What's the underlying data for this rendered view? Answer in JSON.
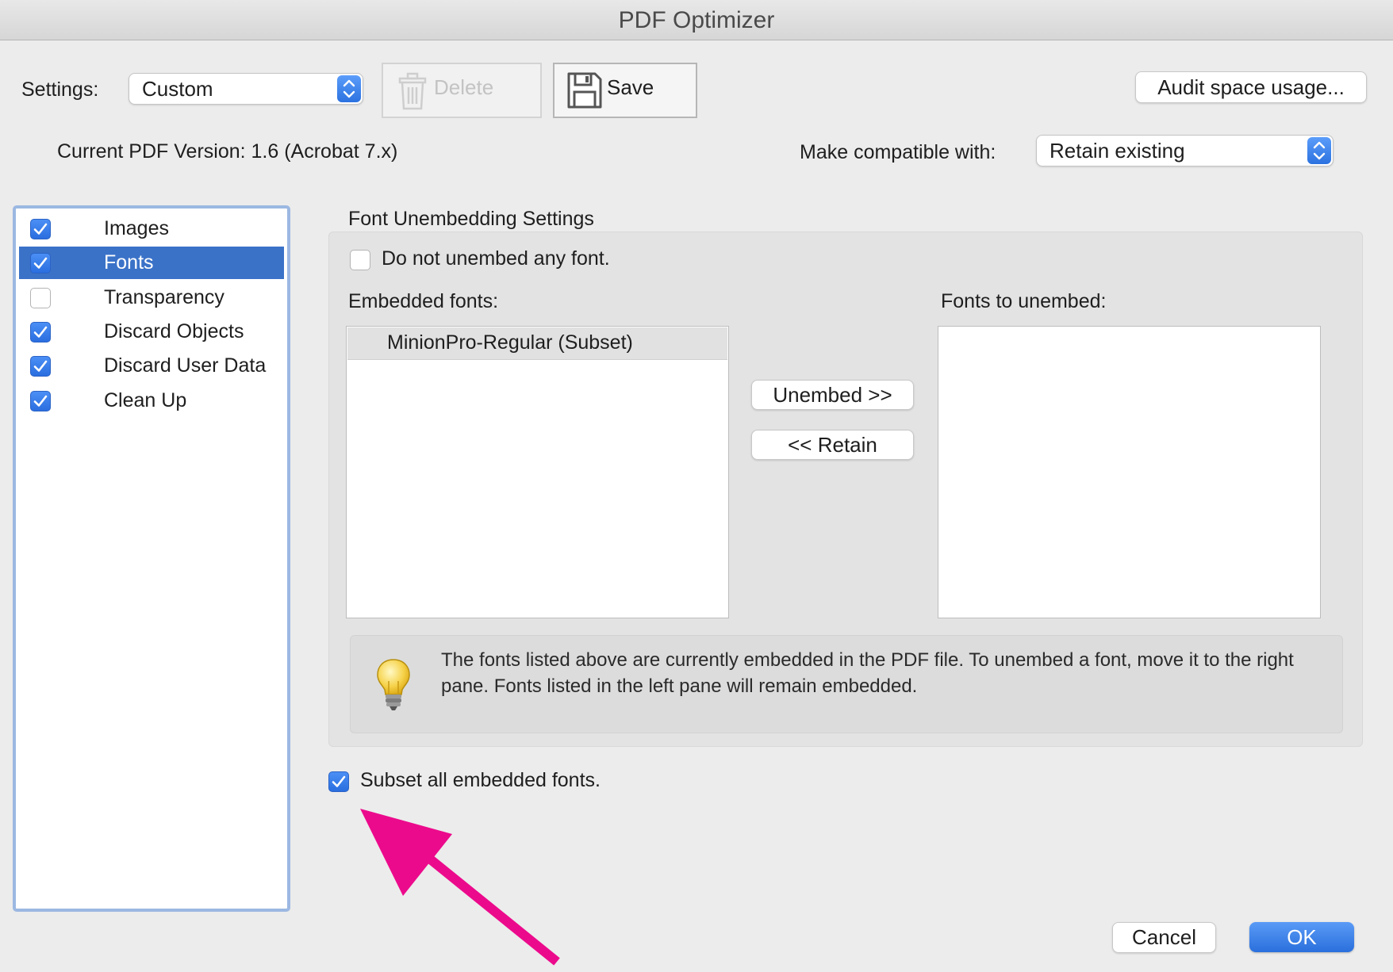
{
  "window": {
    "title": "PDF Optimizer"
  },
  "toolbar": {
    "settings_label": "Settings:",
    "settings_value": "Custom",
    "delete_label": "Delete",
    "save_label": "Save",
    "audit_label": "Audit space usage..."
  },
  "version": {
    "current_label": "Current PDF Version: 1.6 (Acrobat 7.x)",
    "compat_label": "Make compatible with:",
    "compat_value": "Retain existing"
  },
  "sidebar": {
    "items": [
      {
        "label": "Images",
        "checked": true,
        "selected": false
      },
      {
        "label": "Fonts",
        "checked": true,
        "selected": true
      },
      {
        "label": "Transparency",
        "checked": false,
        "selected": false
      },
      {
        "label": "Discard Objects",
        "checked": true,
        "selected": false
      },
      {
        "label": "Discard User Data",
        "checked": true,
        "selected": false
      },
      {
        "label": "Clean Up",
        "checked": true,
        "selected": false
      }
    ]
  },
  "fonts_panel": {
    "section_title": "Font Unembedding Settings",
    "no_unembed_label": "Do not unembed any font.",
    "no_unembed_checked": false,
    "embedded_label": "Embedded fonts:",
    "embedded_fonts": [
      "MinionPro-Regular (Subset)"
    ],
    "unembed_label": "Fonts to unembed:",
    "unembed_button": "Unembed >>",
    "retain_button": "<< Retain",
    "tip_text": "The fonts listed above are currently embedded in the PDF file. To unembed a font, move it to the right pane. Fonts listed in the left pane will remain embedded.",
    "subset_label": "Subset all embedded fonts.",
    "subset_checked": true
  },
  "footer": {
    "cancel_label": "Cancel",
    "ok_label": "OK"
  },
  "colors": {
    "accent": "#2c72e0",
    "annotation_arrow": "#ec0a8c"
  }
}
